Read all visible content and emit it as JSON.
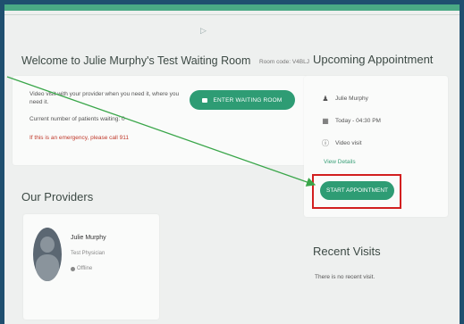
{
  "welcome": {
    "title": "Welcome to Julie Murphy's Test Waiting Room",
    "room_code": "Room code: V4BLJ",
    "description": "Video visit with your provider when you need it, where you need it.",
    "patients_waiting": "Current number of patients waiting: 0",
    "emergency": "If this is an emergency, please call 911",
    "enter_button": "ENTER WAITING ROOM"
  },
  "upcoming": {
    "title": "Upcoming Appointment",
    "provider": "Julie Murphy",
    "time": "Today - 04:30 PM",
    "type": "Video visit",
    "view_details": "View Details",
    "start_button": "START APPOINTMENT"
  },
  "providers": {
    "title": "Our Providers",
    "items": [
      {
        "name": "Julie Murphy",
        "role": "Test Physician",
        "status": "Offline"
      }
    ]
  },
  "recent": {
    "title": "Recent Visits",
    "empty": "There is no recent visit."
  },
  "colors": {
    "brand": "#2e9c74",
    "annotation_arrow": "#3aa64a",
    "highlight": "#d21f1f"
  },
  "icons": [
    "camera-icon",
    "person-icon",
    "calendar-icon",
    "info-icon",
    "cursor-icon"
  ]
}
